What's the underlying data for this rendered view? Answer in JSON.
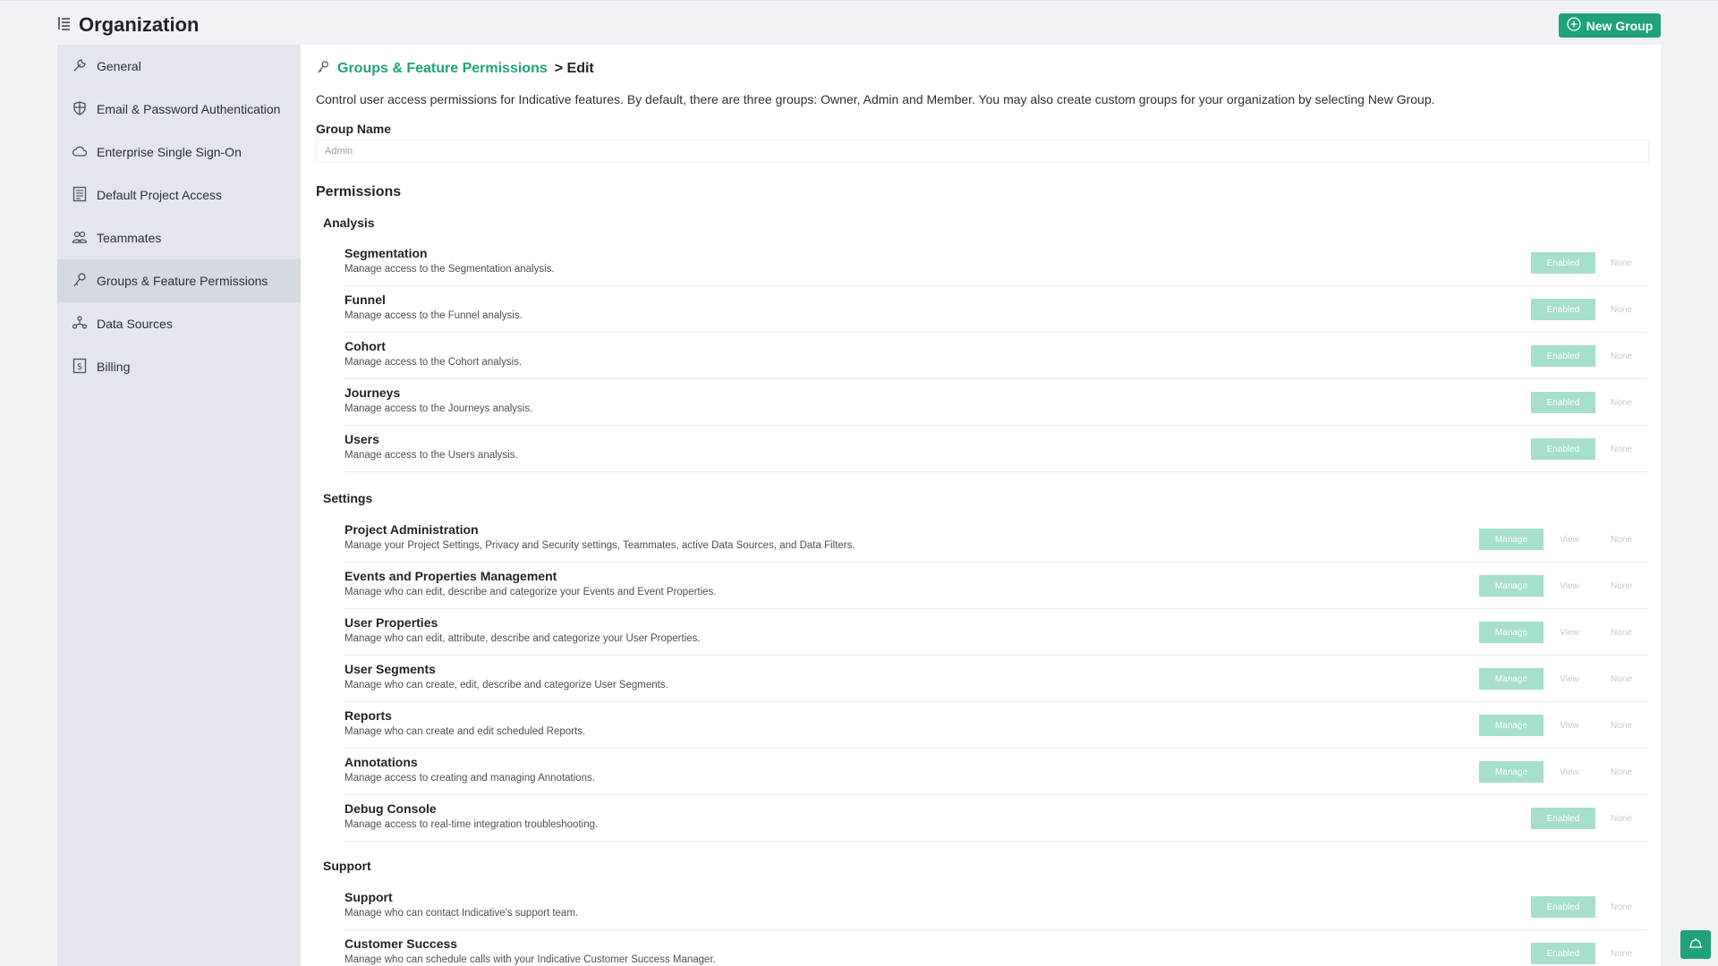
{
  "header": {
    "title": "Organization",
    "new_group_label": "New Group"
  },
  "sidebar": {
    "items": [
      {
        "label": "General",
        "icon": "wrench-icon"
      },
      {
        "label": "Email & Password Authentication",
        "icon": "shield-icon"
      },
      {
        "label": "Enterprise Single Sign-On",
        "icon": "cloud-icon"
      },
      {
        "label": "Default Project Access",
        "icon": "document-icon"
      },
      {
        "label": "Teammates",
        "icon": "people-icon"
      },
      {
        "label": "Groups & Feature Permissions",
        "icon": "key-icon",
        "active": true
      },
      {
        "label": "Data Sources",
        "icon": "network-icon"
      },
      {
        "label": "Billing",
        "icon": "dollar-icon"
      }
    ]
  },
  "main": {
    "breadcrumb_link": "Groups & Feature Permissions",
    "breadcrumb_rest": "> Edit",
    "intro": "Control user access permissions for Indicative features. By default, there are three groups: Owner, Admin and Member. You may also create custom groups for your organization by selecting New Group.",
    "group_name_label": "Group Name",
    "group_name_value": "Admin",
    "permissions_heading": "Permissions",
    "sections": {
      "analysis": {
        "title": "Analysis",
        "rows": [
          {
            "name": "Segmentation",
            "desc": "Manage access to the Segmentation analysis.",
            "options": [
              "Enabled",
              "None"
            ],
            "selected": "Enabled"
          },
          {
            "name": "Funnel",
            "desc": "Manage access to the Funnel analysis.",
            "options": [
              "Enabled",
              "None"
            ],
            "selected": "Enabled"
          },
          {
            "name": "Cohort",
            "desc": "Manage access to the Cohort analysis.",
            "options": [
              "Enabled",
              "None"
            ],
            "selected": "Enabled"
          },
          {
            "name": "Journeys",
            "desc": "Manage access to the Journeys analysis.",
            "options": [
              "Enabled",
              "None"
            ],
            "selected": "Enabled"
          },
          {
            "name": "Users",
            "desc": "Manage access to the Users analysis.",
            "options": [
              "Enabled",
              "None"
            ],
            "selected": "Enabled"
          }
        ]
      },
      "settings": {
        "title": "Settings",
        "rows": [
          {
            "name": "Project Administration",
            "desc": "Manage your Project Settings, Privacy and Security settings, Teammates, active Data Sources, and Data Filters.",
            "options": [
              "Manage",
              "View",
              "None"
            ],
            "selected": "Manage"
          },
          {
            "name": "Events and Properties Management",
            "desc": "Manage who can edit, describe and categorize your Events and Event Properties.",
            "options": [
              "Manage",
              "View",
              "None"
            ],
            "selected": "Manage"
          },
          {
            "name": "User Properties",
            "desc": "Manage who can edit, attribute, describe and categorize your User Properties.",
            "options": [
              "Manage",
              "View",
              "None"
            ],
            "selected": "Manage"
          },
          {
            "name": "User Segments",
            "desc": "Manage who can create, edit, describe and categorize User Segments.",
            "options": [
              "Manage",
              "View",
              "None"
            ],
            "selected": "Manage"
          },
          {
            "name": "Reports",
            "desc": "Manage who can create and edit scheduled Reports.",
            "options": [
              "Manage",
              "View",
              "None"
            ],
            "selected": "Manage"
          },
          {
            "name": "Annotations",
            "desc": "Manage access to creating and managing Annotations.",
            "options": [
              "Manage",
              "View",
              "None"
            ],
            "selected": "Manage"
          },
          {
            "name": "Debug Console",
            "desc": "Manage access to real-time integration troubleshooting.",
            "options": [
              "Enabled",
              "None"
            ],
            "selected": "Enabled"
          }
        ]
      },
      "support": {
        "title": "Support",
        "rows": [
          {
            "name": "Support",
            "desc": "Manage who can contact Indicative's support team.",
            "options": [
              "Enabled",
              "None"
            ],
            "selected": "Enabled"
          },
          {
            "name": "Customer Success",
            "desc": "Manage who can schedule calls with your Indicative Customer Success Manager.",
            "options": [
              "Enabled",
              "None"
            ],
            "selected": "Enabled"
          }
        ]
      }
    }
  },
  "colors": {
    "accent": "#1fa27b",
    "selected_option": "#a6dfcc",
    "sidebar_bg": "#e3e6ec"
  }
}
